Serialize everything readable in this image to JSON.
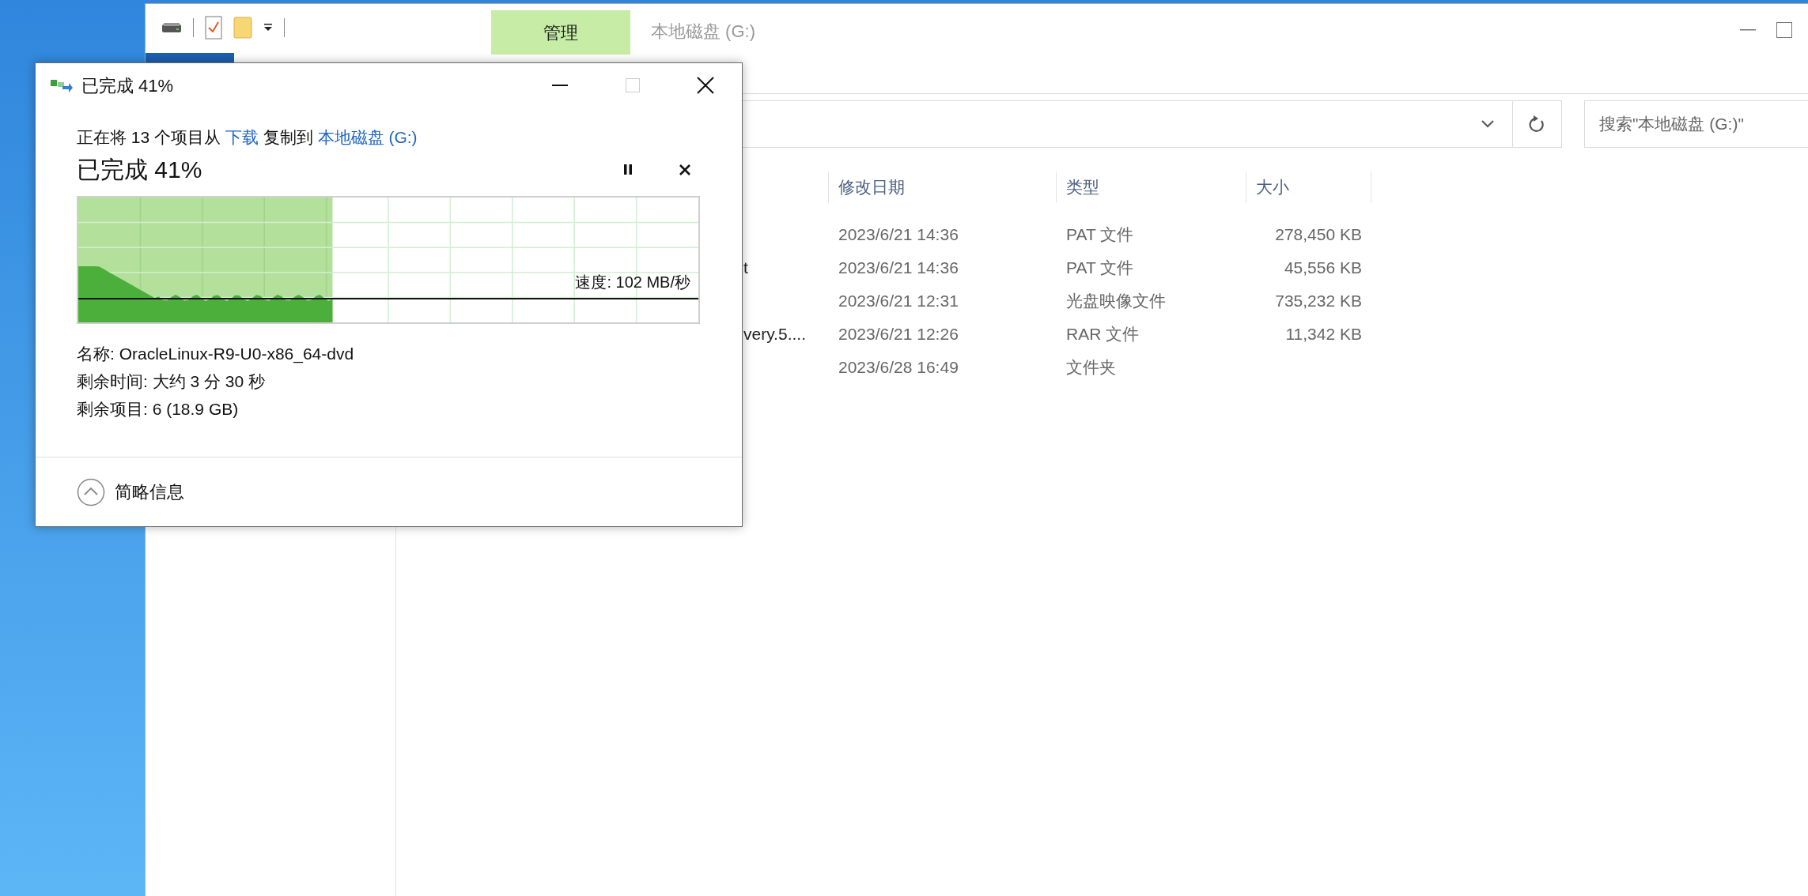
{
  "explorer": {
    "title": "本地磁盘 (G:)",
    "ribbon_tabs": [
      {
        "label": "管理",
        "selected": true
      }
    ],
    "search": {
      "placeholder": "搜索\"本地磁盘 (G:)\""
    },
    "columns": [
      "修改日期",
      "类型",
      "大小"
    ],
    "rows": [
      {
        "modified": "2023/6/21 14:36",
        "type": "PAT 文件",
        "size": "278,450 KB"
      },
      {
        "name": "t",
        "modified": "2023/6/21 14:36",
        "type": "PAT 文件",
        "size": "45,556 KB"
      },
      {
        "modified": "2023/6/21 12:31",
        "type": "光盘映像文件",
        "size": "735,232 KB"
      },
      {
        "name": "very.5....",
        "modified": "2023/6/21 12:26",
        "type": "RAR 文件",
        "size": "11,342 KB"
      },
      {
        "modified": "2023/6/28 16:49",
        "type": "文件夹"
      }
    ]
  },
  "dialog": {
    "title": "已完成 41%",
    "message": [
      {
        "kind": "text",
        "text": "正在将 13 个项目从"
      },
      {
        "kind": "link",
        "text": "下载"
      },
      {
        "kind": "text",
        "text": "复制到"
      },
      {
        "kind": "link",
        "text": "本地磁盘 (G:)"
      }
    ],
    "heading": "已完成 41%",
    "level": 0.41,
    "speed": "速度: 102 MB/秒",
    "details": [
      "名称: OracleLinux-R9-U0-x86_64-dvd",
      "剩余时间: 大约 3 分 30 秒",
      "剩余项目: 6 (18.9 GB)"
    ],
    "maximize_disabled": true,
    "toggle": {
      "label": "简略信息",
      "expanded": true
    }
  }
}
